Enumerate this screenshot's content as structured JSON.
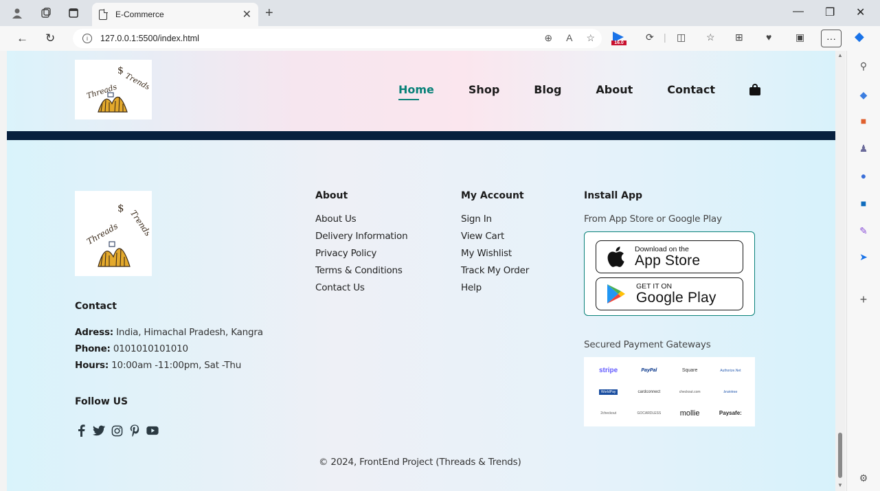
{
  "browser": {
    "tab_title": "E-Commerce",
    "url": "127.0.0.1:5500/index.html",
    "extension_badge": "16.0"
  },
  "site": {
    "logo_text": "Threads $ Trends",
    "nav": [
      {
        "label": "Home",
        "active": true
      },
      {
        "label": "Shop",
        "active": false
      },
      {
        "label": "Blog",
        "active": false
      },
      {
        "label": "About",
        "active": false
      },
      {
        "label": "Contact",
        "active": false
      }
    ],
    "colors": {
      "accent": "#088178",
      "header_bar": "#07203e"
    }
  },
  "footer": {
    "contact": {
      "title": "Contact",
      "address_label": "Adress:",
      "address_value": " India, Himachal Pradesh, Kangra",
      "phone_label": "Phone:",
      "phone_value": " 0101010101010",
      "hours_label": "Hours:",
      "hours_value": " 10:00am -11:00pm, Sat -Thu"
    },
    "follow": {
      "title": "Follow US",
      "icons": [
        "facebook-icon",
        "twitter-icon",
        "instagram-icon",
        "pinterest-icon",
        "youtube-icon"
      ]
    },
    "about": {
      "title": "About",
      "links": [
        "About Us",
        "Delivery Information",
        "Privacy Policy",
        "Terms & Conditions",
        "Contact Us"
      ]
    },
    "account": {
      "title": "My Account",
      "links": [
        "Sign In",
        "View Cart",
        "My Wishlist",
        "Track My Order",
        "Help"
      ]
    },
    "install": {
      "title": "Install App",
      "subtitle": "From App Store or Google Play",
      "appstore_small": "Download on the",
      "appstore_big": "App Store",
      "googleplay_small": "GET IT ON",
      "googleplay_big": "Google Play",
      "payment_title": "Secured Payment Gateways",
      "payment_logos": [
        "stripe",
        "PayPal",
        "Square",
        "Authorize.Net",
        "WorldPay",
        "cardconnect",
        "checkout.com",
        "braintree",
        "2checkout",
        "GOCARDLESS",
        "mollie",
        "Paysafe:"
      ]
    },
    "copyright": "© 2024, FrontEnd Project (Threads & Trends)"
  }
}
